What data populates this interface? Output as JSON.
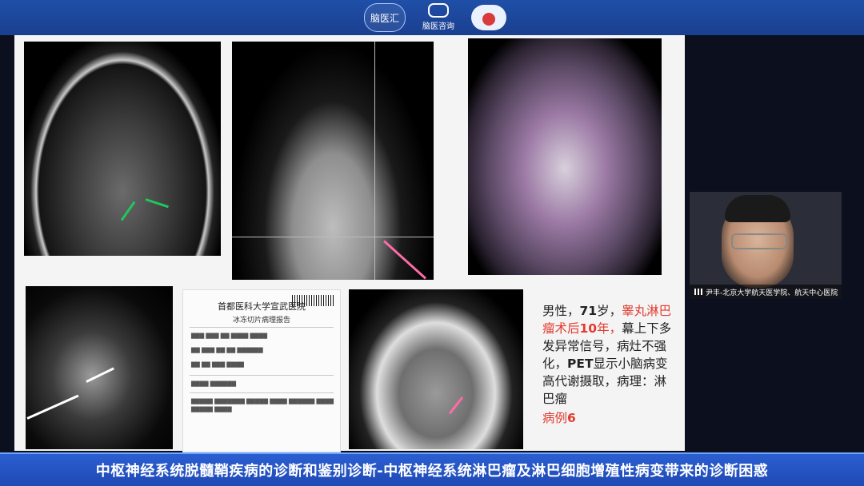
{
  "header": {
    "logo1_text": "脑医汇",
    "logo2_text": "脑医咨询"
  },
  "report": {
    "hospital": "首都医科大学宣武医院",
    "title": "冰冻切片病理报告"
  },
  "case_note": {
    "line1_prefix": "男性，",
    "age": "71",
    "line1_suffix": "岁，",
    "highlight_part1": "睾丸淋巴瘤术后",
    "highlight_years": "10",
    "highlight_part2": "年，",
    "body1": "幕上下多发异常信号，病灶不强化，",
    "pet_label": "PET",
    "body2": "显示小脑病变高代谢摄取，病理：淋巴瘤",
    "case_label": "病例",
    "case_number": "6"
  },
  "video": {
    "speaker_label": "尹丰-北京大学航天医学院、航天中心医院"
  },
  "footer": {
    "title": "中枢神经系统脱髓鞘疾病的诊断和鉴别诊断-中枢神经系统淋巴瘤及淋巴细胞增殖性病变带来的诊断困惑"
  },
  "colors": {
    "header_blue": "#1f4fa8",
    "footer_blue": "#2b5fd1",
    "highlight_red": "#e23b2e",
    "green_arrow": "#22c55e",
    "pink_arrow": "#ff6aa8"
  }
}
